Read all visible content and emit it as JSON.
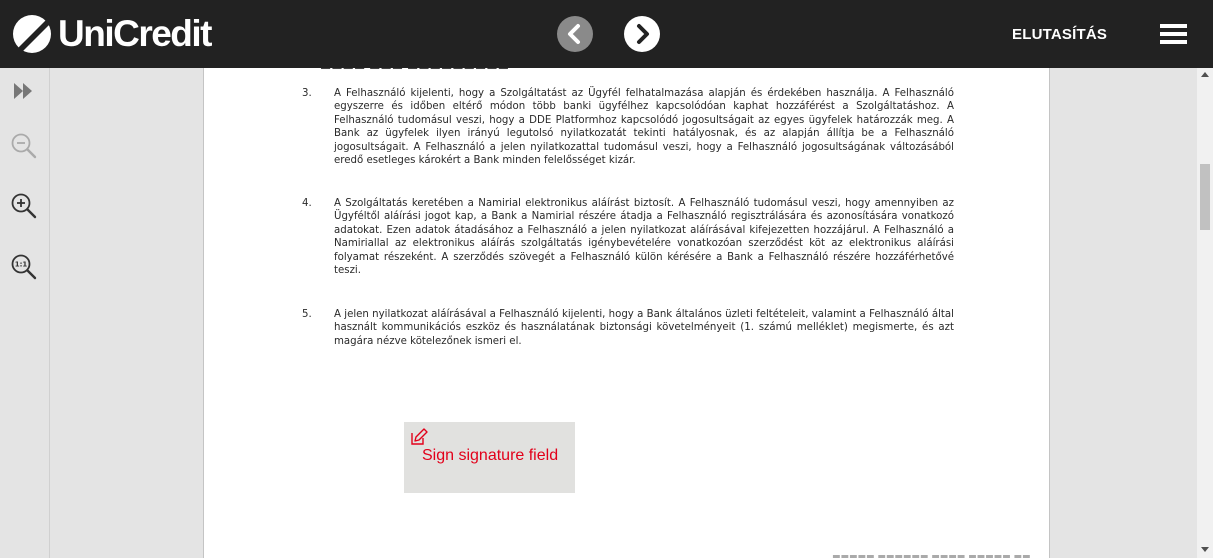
{
  "header": {
    "logo_text": "UniCredit",
    "reject_label": "ELUTASÍTÁS",
    "prev_icon": "chevron-left-icon",
    "next_icon": "chevron-right-icon",
    "menu_icon": "hamburger-menu-icon"
  },
  "toolbar": {
    "items": [
      {
        "icon": "expand-panel-icon"
      },
      {
        "icon": "zoom-out-icon"
      },
      {
        "icon": "zoom-in-icon"
      },
      {
        "icon": "zoom-actual-size-icon"
      }
    ]
  },
  "document": {
    "items": [
      {
        "number": "3.",
        "text": "A Felhasználó kijelenti, hogy a Szolgáltatást az Ügyfél felhatalmazása alapján és érdekében használja. A Felhasználó egyszerre és időben eltérő módon több banki ügyfélhez kapcsolódóan kaphat hozzáférést a Szolgáltatáshoz. A Felhasználó tudomásul veszi, hogy a DDE Platformhoz kapcsolódó jogosultságait az egyes ügyfelek határozzák meg. A Bank az ügyfelek ilyen irányú legutolsó nyilatkozatát tekinti hatályosnak, és az alapján állítja be a Felhasználó jogosultságait. A Felhasználó a jelen nyilatkozattal tudomásul veszi, hogy a Felhasználó jogosultságának változásából eredő esetleges károkért a Bank minden felelősséget kizár."
      },
      {
        "number": "4.",
        "text": "A Szolgáltatás keretében a Namirial elektronikus aláírást biztosít. A Felhasználó tudomásul veszi, hogy amennyiben az Ügyféltől aláírási jogot kap, a Bank a Namirial részére átadja a Felhasználó regisztrálására és azonosítására vonatkozó adatokat. Ezen adatok átadásához a Felhasználó a jelen nyilatkozat aláírásával kifejezetten hozzájárul. A Felhasználó a Namiriallal az elektronikus aláírás szolgáltatás igénybevételére vonatkozóan szerződést köt az elektronikus aláírási folyamat részeként. A szerződés szövegét a Felhasználó külön kérésére a Bank a Felhasználó részére hozzáférhetővé teszi."
      },
      {
        "number": "5.",
        "text": "A jelen nyilatkozat aláírásával a Felhasználó kijelenti, hogy a Bank általános üzleti feltételeit, valamint a Felhasználó által használt kommunikációs eszköz és használatának biztonsági követelményeit (1. számú melléklet) megismerte, és azt magára nézve kötelezőnek ismeri el."
      }
    ],
    "signature": {
      "icon": "edit-signature-icon",
      "label": "Sign signature field"
    }
  },
  "colors": {
    "header_bg": "#222222",
    "accent_red": "#e2001a",
    "viewer_bg": "#e4e4e4"
  }
}
